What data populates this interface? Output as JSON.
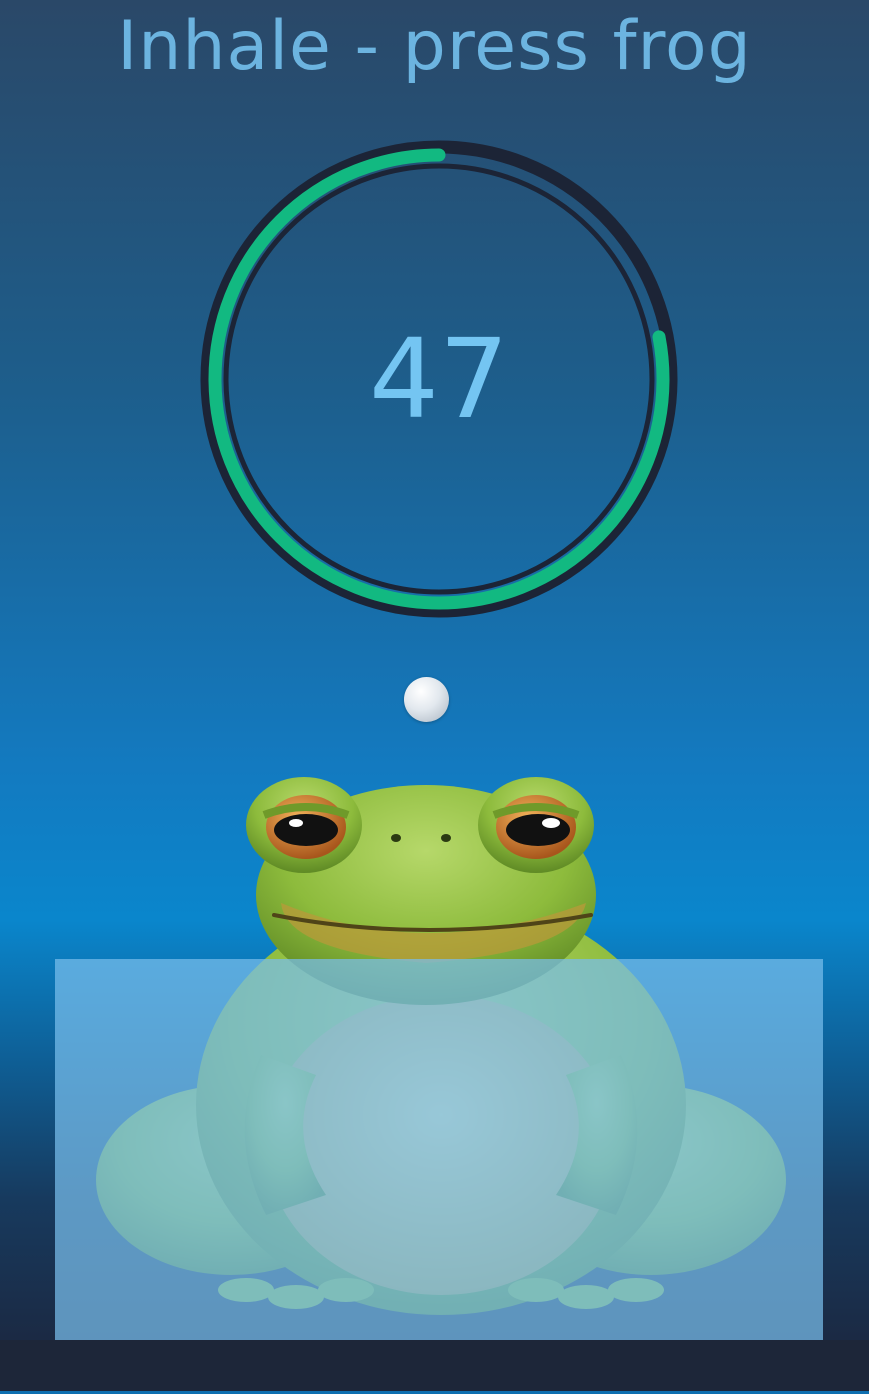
{
  "prompt": {
    "text": "Inhale - press frog"
  },
  "timer": {
    "value": "47",
    "progress_fraction": 0.78
  },
  "colors": {
    "title": "#6cb4e0",
    "timer_text": "#74c5f2",
    "ring_progress": "#12b981",
    "ring_track": "#1c2436",
    "water": "#78beeb",
    "bottom_bar": "#1d2639"
  },
  "icons": {
    "frog": "frog-illustration",
    "indicator": "breath-indicator-dot"
  }
}
